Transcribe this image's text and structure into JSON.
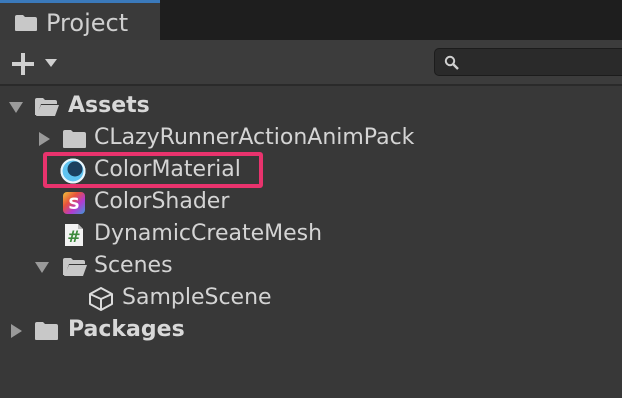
{
  "tab": {
    "label": "Project"
  },
  "toolbar": {
    "add_label": "+",
    "search_placeholder": ""
  },
  "tree": {
    "assets": "Assets",
    "pack": "CLazyRunnerActionAnimPack",
    "material": "ColorMaterial",
    "shader": "ColorShader",
    "shader_glyph": "S",
    "script": "DynamicCreateMesh",
    "script_glyph": "#",
    "scenes": "Scenes",
    "sample": "SampleScene",
    "packages": "Packages"
  },
  "colors": {
    "highlight": "#e8336d",
    "tab_accent": "#3a79bb",
    "material_icon": "#5fc3f0",
    "script_icon": "#3d8a3d"
  }
}
